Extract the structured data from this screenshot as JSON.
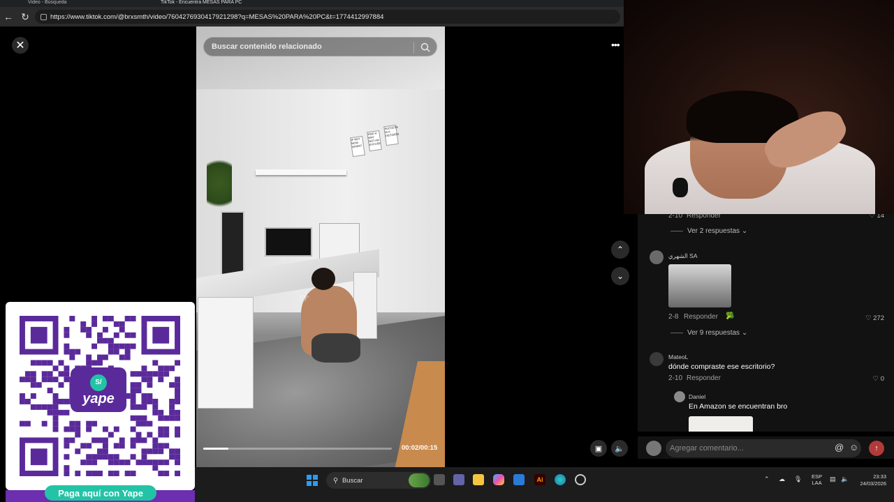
{
  "browser": {
    "tab_1_title": "Video - Búsqueda",
    "tab_2_title": "TikTok - Encuentra MESAS PARA PC",
    "url": "https://www.tiktok.com/@brxsmth/video/7604276930417921298?q=MESAS%20PARA%20PC&t=1774412997884"
  },
  "video": {
    "search_placeholder": "Buscar contenido relacionado",
    "time": "00:02/00:15",
    "progress": 0.135,
    "posters": [
      "IF NOT NOW WHEN?",
      "FIND A WAY NOT AN EXCUSE",
      "SUCCESS IS A DECISION"
    ]
  },
  "comments": {
    "row0_reply": "Responder",
    "row0_date": "2-10",
    "row0_likes": "14",
    "view_replies_1": "Ver 2 respuestas",
    "c1_name": "الشهري SA",
    "c1_date": "2-8",
    "c1_reply": "Responder",
    "c1_likes": "272",
    "view_replies_2": "Ver 9 respuestas",
    "c2_name": "MateoL",
    "c2_text": "dónde compraste ese escritorio?",
    "c2_date": "2-10",
    "c2_reply": "Responder",
    "c2_likes": "0",
    "c3_name": "Daniel",
    "c3_text": "En Amazon se encuentran bro",
    "input_placeholder": "Agregar comentario..."
  },
  "yape": {
    "coin": "S/",
    "brand": "yape",
    "cta": "Paga aquí con Yape"
  },
  "taskbar": {
    "search": "Buscar",
    "lang_1": "ESP",
    "lang_2": "LAA",
    "time": "23:33",
    "date": "24/03/2026"
  },
  "colors": {
    "yape_purple": "#6b2fb0",
    "yape_green": "#23c3a6",
    "tiktok_send": "#b23a3a"
  }
}
